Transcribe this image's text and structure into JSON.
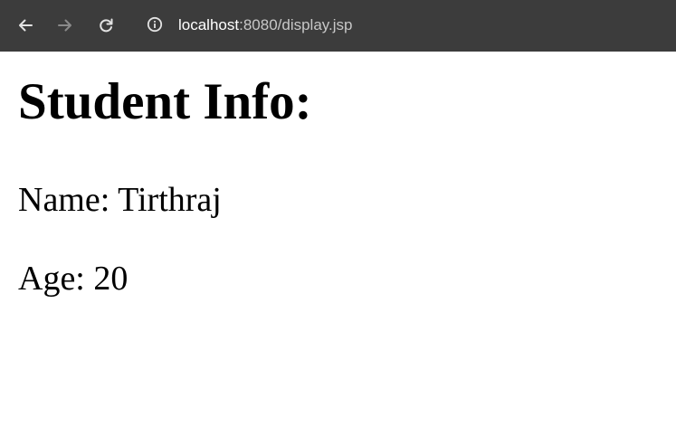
{
  "browser": {
    "url_host": "localhost",
    "url_rest": ":8080/display.jsp",
    "icons": {
      "back": "arrow-left-icon",
      "forward": "arrow-right-icon",
      "reload": "reload-icon",
      "site_info": "info-circle-icon"
    },
    "colors": {
      "toolbar_bg": "#3c3c3c",
      "icon_active": "#e3e3e3",
      "icon_disabled": "#8a8a8a"
    }
  },
  "page": {
    "heading": "Student Info:",
    "name_line": "Name: Tirthraj",
    "age_line": "Age: 20"
  }
}
